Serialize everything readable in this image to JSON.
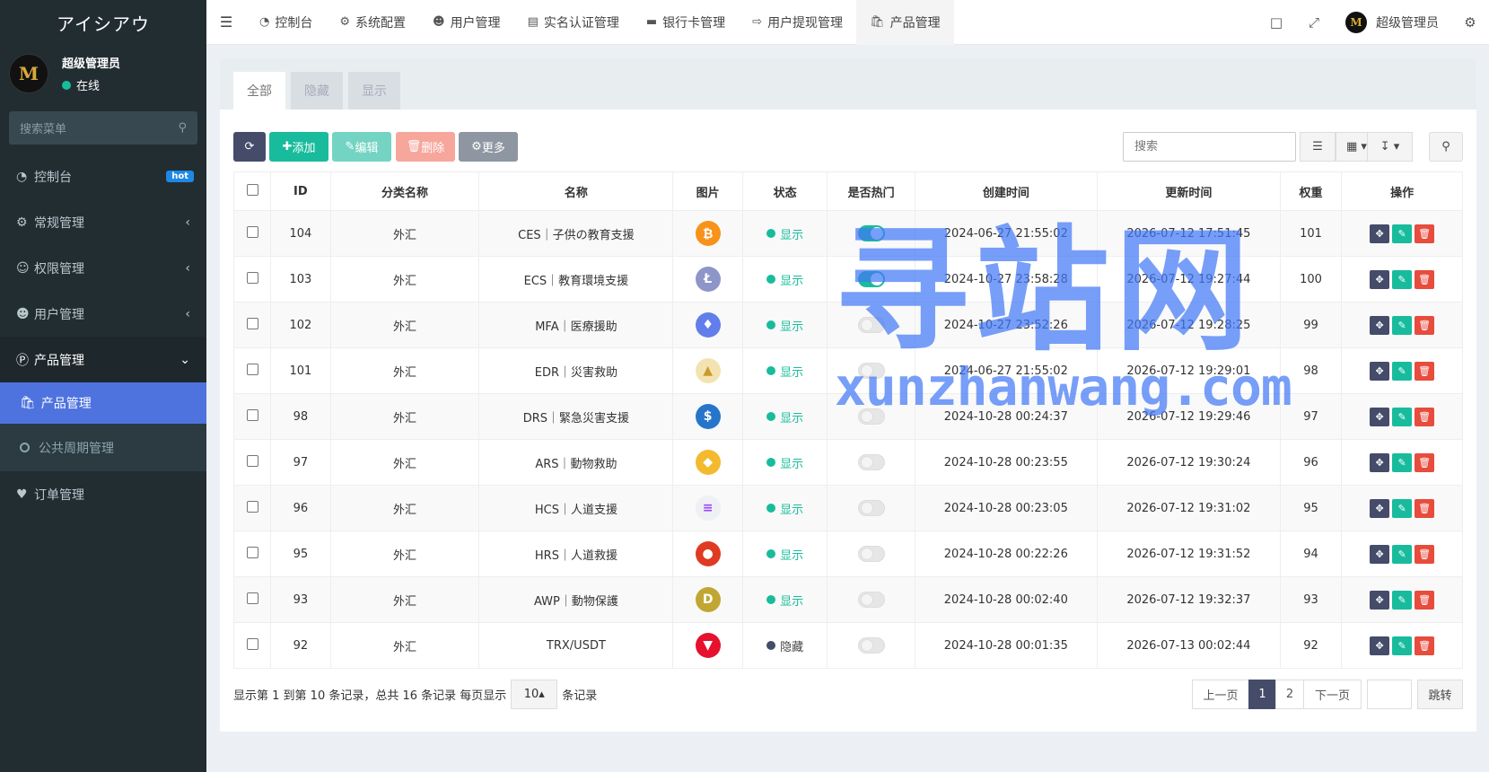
{
  "brand": "アイシアウ",
  "user": {
    "name": "超级管理员",
    "status": "在线",
    "avatar": "M"
  },
  "sidebar": {
    "search_placeholder": "搜索菜单",
    "items": [
      {
        "label": "控制台",
        "icon": "dashboard-icon",
        "badge": "hot"
      },
      {
        "label": "常规管理",
        "icon": "cogs-icon"
      },
      {
        "label": "权限管理",
        "icon": "users-icon"
      },
      {
        "label": "用户管理",
        "icon": "user-circle-icon"
      },
      {
        "label": "产品管理",
        "icon": "product-icon"
      }
    ],
    "sub_items": [
      {
        "label": "产品管理",
        "icon": "bag-icon"
      },
      {
        "label": "公共周期管理",
        "icon": "circle-icon"
      }
    ],
    "order": {
      "label": "订单管理",
      "icon": "heart-icon"
    }
  },
  "topnav": {
    "tabs": [
      "控制台",
      "系统配置",
      "用户管理",
      "实名认证管理",
      "银行卡管理",
      "用户提现管理",
      "产品管理"
    ],
    "user": "超级管理员"
  },
  "panel": {
    "tabs": [
      "全部",
      "隐藏",
      "显示"
    ],
    "toolbar": {
      "add": "添加",
      "edit": "编辑",
      "delete": "删除",
      "more": "更多",
      "search_placeholder": "搜索"
    },
    "columns": [
      "ID",
      "分类名称",
      "名称",
      "图片",
      "状态",
      "是否热门",
      "创建时间",
      "更新时间",
      "权重",
      "操作"
    ],
    "rows": [
      {
        "id": "104",
        "cat": "外汇",
        "name": "CES｜子供の教育支援",
        "coin": "bitcoin",
        "status": "显示",
        "hot": true,
        "created": "2024-06-27 21:55:02",
        "updated": "2026-07-12 17:51:45",
        "weight": "101"
      },
      {
        "id": "103",
        "cat": "外汇",
        "name": "ECS｜教育環境支援",
        "coin": "litecoin",
        "status": "显示",
        "hot": true,
        "created": "2024-10-27 23:58:28",
        "updated": "2026-07-12 19:27:44",
        "weight": "100"
      },
      {
        "id": "102",
        "cat": "外汇",
        "name": "MFA｜医療援助",
        "coin": "ethereum",
        "status": "显示",
        "hot": false,
        "created": "2024-10-27 23:52:26",
        "updated": "2026-07-12 19:28:25",
        "weight": "99"
      },
      {
        "id": "101",
        "cat": "外汇",
        "name": "EDR｜災害救助",
        "coin": "tether-gold",
        "status": "显示",
        "hot": false,
        "created": "2024-06-27 21:55:02",
        "updated": "2026-07-12 19:29:01",
        "weight": "98"
      },
      {
        "id": "98",
        "cat": "外汇",
        "name": "DRS｜緊急災害支援",
        "coin": "usd-coin",
        "status": "显示",
        "hot": false,
        "created": "2024-10-28 00:24:37",
        "updated": "2026-07-12 19:29:46",
        "weight": "97"
      },
      {
        "id": "97",
        "cat": "外汇",
        "name": "ARS｜動物救助",
        "coin": "binance",
        "status": "显示",
        "hot": false,
        "created": "2024-10-28 00:23:55",
        "updated": "2026-07-12 19:30:24",
        "weight": "96"
      },
      {
        "id": "96",
        "cat": "外汇",
        "name": "HCS｜人道支援",
        "coin": "solana",
        "status": "显示",
        "hot": false,
        "created": "2024-10-28 00:23:05",
        "updated": "2026-07-12 19:31:02",
        "weight": "95"
      },
      {
        "id": "95",
        "cat": "外汇",
        "name": "HRS｜人道救援",
        "coin": "shiba",
        "status": "显示",
        "hot": false,
        "created": "2024-10-28 00:22:26",
        "updated": "2026-07-12 19:31:52",
        "weight": "94"
      },
      {
        "id": "93",
        "cat": "外汇",
        "name": "AWP｜動物保護",
        "coin": "dogecoin",
        "status": "显示",
        "hot": false,
        "created": "2024-10-28 00:02:40",
        "updated": "2026-07-12 19:32:37",
        "weight": "93"
      },
      {
        "id": "92",
        "cat": "外汇",
        "name": "TRX/USDT",
        "coin": "tron",
        "status": "隐藏",
        "hot": false,
        "created": "2024-10-28 00:01:35",
        "updated": "2026-07-13 00:02:44",
        "weight": "92"
      }
    ],
    "footer": {
      "summary": "显示第 1 到第 10 条记录，总共 16 条记录 每页显示",
      "page_size": "10",
      "suffix": "条记录",
      "prev": "上一页",
      "pages": [
        "1",
        "2"
      ],
      "next": "下一页",
      "go": "跳转"
    }
  },
  "watermark": {
    "big": "寻站网",
    "small": "xunzhanwang.com"
  },
  "colors": {
    "sidebar": "#222d32",
    "accent": "#18bc9c",
    "active_menu": "#4e73df",
    "danger": "#e74c3c",
    "dark_btn": "#444c69"
  }
}
